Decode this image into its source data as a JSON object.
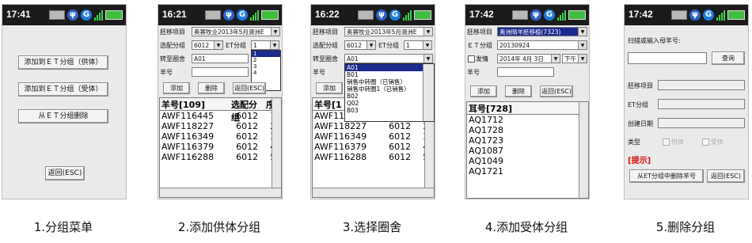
{
  "screens": [
    {
      "time": "17:41",
      "buttons": [
        "添加到ＥＴ分组（供体）",
        "添加到ＥＴ分组（受体）",
        "从ＥＴ分组删除"
      ],
      "back": "返回(ESC)",
      "caption": "1.分组菜单"
    },
    {
      "time": "16:21",
      "labels": {
        "project": "胚移项目",
        "group": "选配分组",
        "et": "ET分组",
        "pen": "转至圈舍",
        "sheep": "羊号"
      },
      "values": {
        "project": "奥赛牧业2013年5月澳洲E",
        "group": "6012",
        "et": "1",
        "pen": "A01"
      },
      "et_options": [
        "1",
        "2",
        "3",
        "4"
      ],
      "buttons": {
        "add": "添加",
        "del": "删除",
        "back": "返回(ESC)"
      },
      "table": {
        "headers": [
          "羊号[109]",
          "选配分组",
          "序"
        ],
        "rows": [
          [
            "AWF116445",
            "6012",
            "1"
          ],
          [
            "AWF118227",
            "6012",
            "2"
          ],
          [
            "AWF116349",
            "6012",
            "3"
          ],
          [
            "AWF116379",
            "6012",
            "4"
          ],
          [
            "AWF116288",
            "6012",
            "5"
          ]
        ]
      },
      "caption": "2.添加供体分组"
    },
    {
      "time": "16:22",
      "labels": {
        "project": "胚移项目",
        "group": "选配分组",
        "et": "ET分组",
        "pen": "转至圈舍",
        "sheep": "羊号"
      },
      "values": {
        "project": "奥赛牧业2013年5月澳洲E",
        "group": "6012",
        "et": "1",
        "pen": "A01"
      },
      "pen_options": [
        "A01",
        "B01",
        "销售中转圈（已销售）",
        "销售中转圈1（已销售）",
        "B02",
        "Q02",
        "B03"
      ],
      "buttons": {
        "add": "添加"
      },
      "table": {
        "headers": [
          "羊号[1",
          ""
        ],
        "rows": [
          [
            "AWF11",
            "",
            ""
          ],
          [
            "AWF118227",
            "6012",
            "2"
          ],
          [
            "AWF116349",
            "6012",
            "3"
          ],
          [
            "AWF116379",
            "6012",
            "4"
          ],
          [
            "AWF116288",
            "6012",
            "5"
          ]
        ]
      },
      "caption": "3.选择圈舍"
    },
    {
      "time": "17:42",
      "labels": {
        "project": "胚移项目",
        "et": "ＥＴ分组",
        "date": "发情",
        "sheep": "羊号"
      },
      "values": {
        "project": "奥洲晴羊胚移植(7323)",
        "et": "20130924",
        "date": "2014年 4月 3日",
        "ampm": "下午"
      },
      "buttons": {
        "add": "添加",
        "del": "删除",
        "back": "返回(ESC)"
      },
      "table": {
        "headers": [
          "耳号[728]"
        ],
        "rows": [
          "AQ1712",
          "AQ1728",
          "AQ1723",
          "AQ1087",
          "AQ1049",
          "AQ1721"
        ]
      },
      "caption": "4.添加受体分组"
    },
    {
      "time": "17:42",
      "labels": {
        "scan": "扫描或输入母羊号:",
        "project": "胚移项目",
        "et": "ET分组",
        "created": "创建日期",
        "type": "类型",
        "donor": "供体",
        "recipient": "受体",
        "tip": "[提示]"
      },
      "buttons": {
        "query": "查询",
        "delete": "从ET分组中删除羊号",
        "back": "返回(ESC)"
      },
      "caption": "5.删除分组"
    }
  ]
}
